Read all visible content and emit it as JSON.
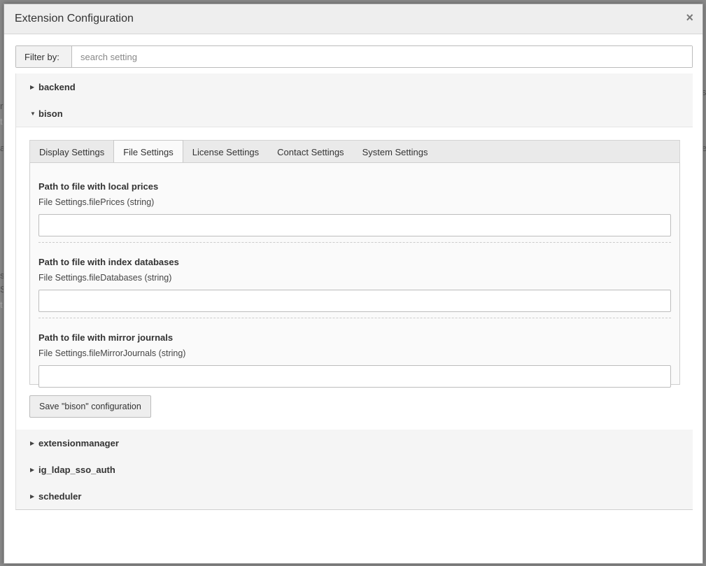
{
  "background_fragments": [
    "r",
    "t",
    "a",
    "s",
    "S",
    "t",
    "e",
    "s",
    "a"
  ],
  "modal": {
    "title": "Extension Configuration",
    "close_label": "×"
  },
  "filter": {
    "label": "Filter by:",
    "placeholder": "search setting",
    "value": ""
  },
  "panels": [
    {
      "name": "backend",
      "expanded": false
    },
    {
      "name": "bison",
      "expanded": true
    },
    {
      "name": "extensionmanager",
      "expanded": false
    },
    {
      "name": "ig_ldap_sso_auth",
      "expanded": false
    },
    {
      "name": "scheduler",
      "expanded": false
    }
  ],
  "icons": {
    "collapsed": "caret-right-icon",
    "expanded": "caret-down-icon",
    "close": "close-icon"
  },
  "bison": {
    "tabs": [
      "Display Settings",
      "File Settings",
      "License Settings",
      "Contact Settings",
      "System Settings"
    ],
    "active_tab": "File Settings",
    "fields": [
      {
        "title": "Path to file with local prices",
        "description": "File Settings.filePrices (string)",
        "value": ""
      },
      {
        "title": "Path to file with index databases",
        "description": "File Settings.fileDatabases (string)",
        "value": ""
      },
      {
        "title": "Path to file with mirror journals",
        "description": "File Settings.fileMirrorJournals (string)",
        "value": ""
      }
    ],
    "save_label": "Save \"bison\" configuration"
  }
}
